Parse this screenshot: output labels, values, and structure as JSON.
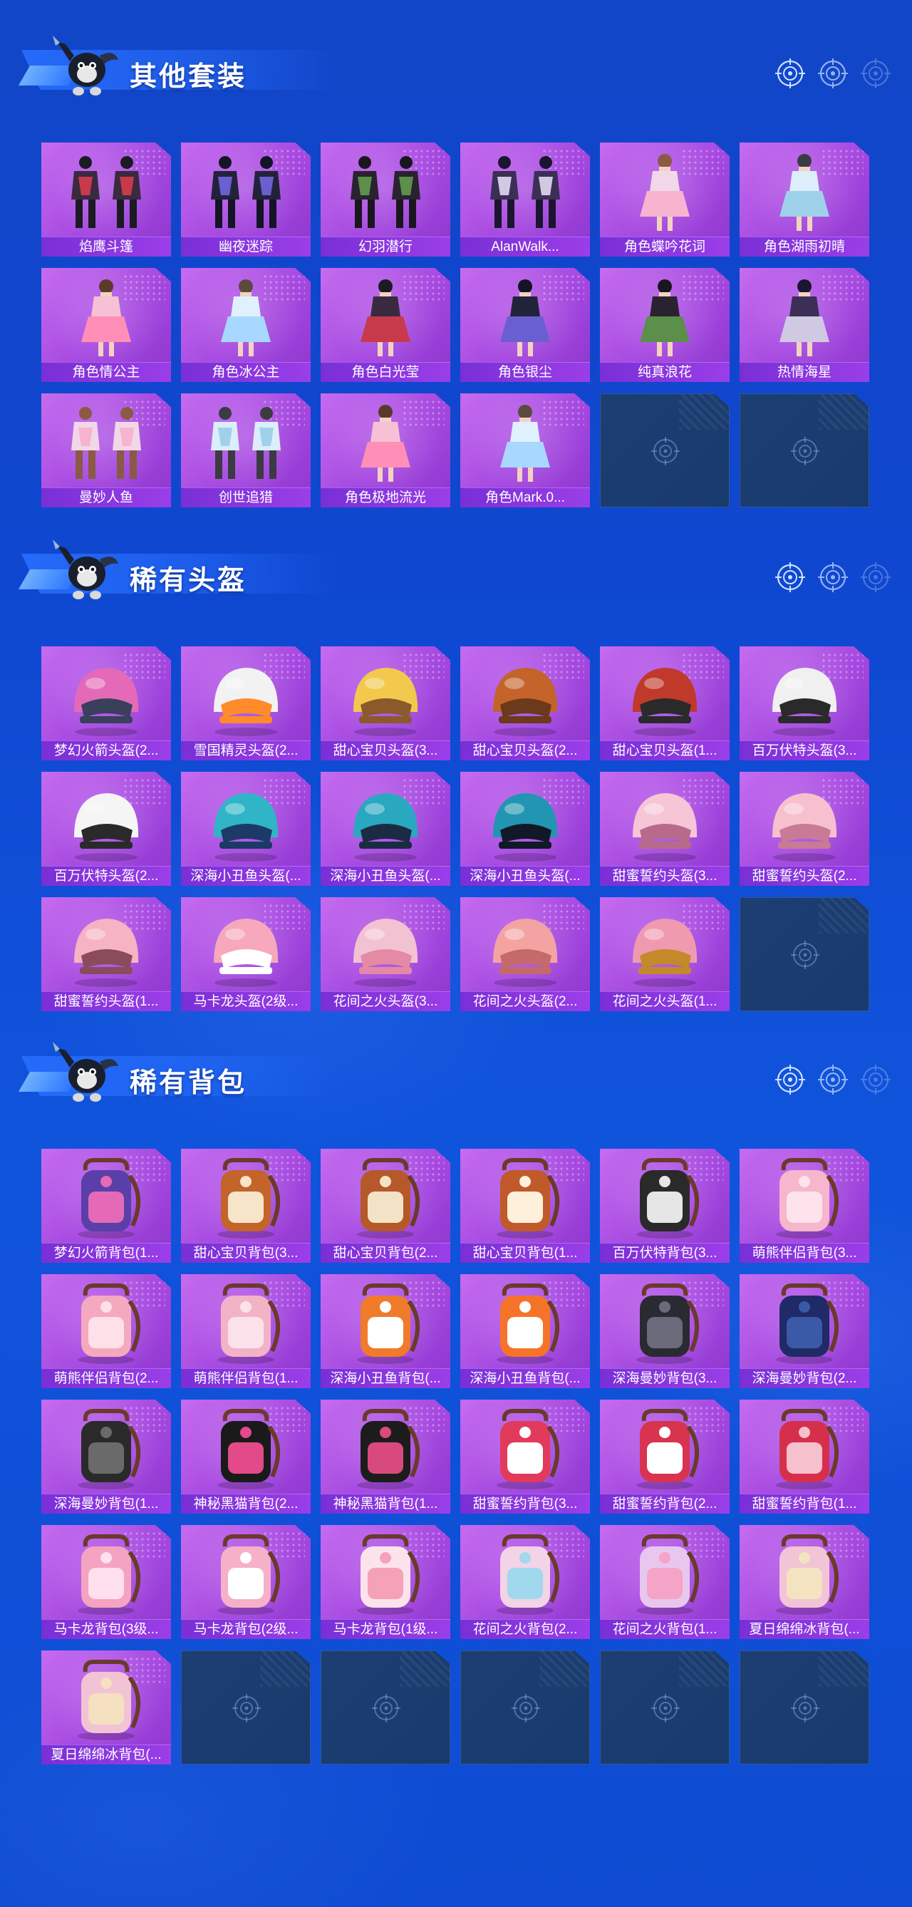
{
  "sections": [
    {
      "title": "其他套装",
      "items": [
        "焰鹰斗篷",
        "幽夜迷踪",
        "幻羽潜行",
        "AlanWalk...",
        "角色蝶吟花词",
        "角色湖雨初晴",
        "角色情公主",
        "角色冰公主",
        "角色白光莹",
        "角色银尘",
        "纯真浪花",
        "热情海星",
        "曼妙人鱼",
        "创世追猎",
        "角色极地流光",
        "角色Mark.0..."
      ],
      "empty_slots": 2
    },
    {
      "title": "稀有头盔",
      "items": [
        "梦幻火箭头盔(2...",
        "雪国精灵头盔(2...",
        "甜心宝贝头盔(3...",
        "甜心宝贝头盔(2...",
        "甜心宝贝头盔(1...",
        "百万伏特头盔(3...",
        "百万伏特头盔(2...",
        "深海小丑鱼头盔(...",
        "深海小丑鱼头盔(...",
        "深海小丑鱼头盔(...",
        "甜蜜誓约头盔(3...",
        "甜蜜誓约头盔(2...",
        "甜蜜誓约头盔(1...",
        "马卡龙头盔(2级...",
        "花间之火头盔(3...",
        "花间之火头盔(2...",
        "花间之火头盔(1..."
      ],
      "empty_slots": 1
    },
    {
      "title": "稀有背包",
      "items": [
        "梦幻火箭背包(1...",
        "甜心宝贝背包(3...",
        "甜心宝贝背包(2...",
        "甜心宝贝背包(1...",
        "百万伏特背包(3...",
        "萌熊伴侣背包(3...",
        "萌熊伴侣背包(2...",
        "萌熊伴侣背包(1...",
        "深海小丑鱼背包(...",
        "深海小丑鱼背包(...",
        "深海曼妙背包(3...",
        "深海曼妙背包(2...",
        "深海曼妙背包(1...",
        "神秘黑猫背包(2...",
        "神秘黑猫背包(1...",
        "甜蜜誓约背包(3...",
        "甜蜜誓约背包(2...",
        "甜蜜誓约背包(1...",
        "马卡龙背包(3级...",
        "马卡龙背包(2级...",
        "马卡龙背包(1级...",
        "花间之火背包(2...",
        "花间之火背包(1...",
        "夏日绵绵冰背包(...",
        "夏日绵绵冰背包(..."
      ],
      "empty_slots": 5
    }
  ],
  "colors": {
    "background": "#1246c8",
    "tile_purple": "#a548e0",
    "caption_purple": "#8a36e0",
    "empty_tile": "#1c3e73"
  },
  "icons": {
    "header_target": "crosshair-target-icon",
    "empty_slot": "crosshair-placeholder-icon",
    "mascot": "mascot-character-icon"
  }
}
